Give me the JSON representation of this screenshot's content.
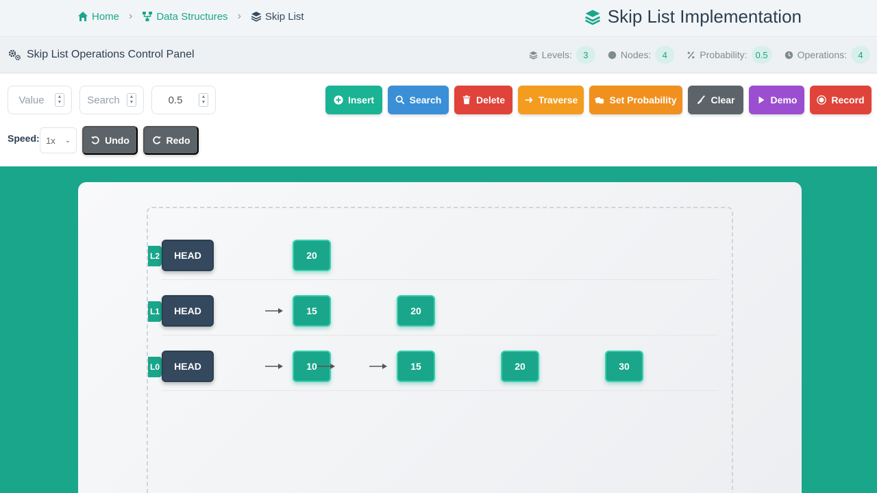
{
  "breadcrumb": {
    "home": "Home",
    "data_structures": "Data Structures",
    "current": "Skip List"
  },
  "app_title": "Skip List Implementation",
  "panel_title": "Skip List Operations Control Panel",
  "stats": {
    "levels_label": "Levels:",
    "levels_value": "3",
    "nodes_label": "Nodes:",
    "nodes_value": "4",
    "probability_label": "Probability:",
    "probability_value": "0.5",
    "operations_label": "Operations:",
    "operations_value": "4"
  },
  "inputs": {
    "value_placeholder": "Value",
    "search_placeholder": "Search",
    "probability_value": "0.5"
  },
  "buttons": {
    "insert": "Insert",
    "search": "Search",
    "delete": "Delete",
    "traverse": "Traverse",
    "set_probability": "Set Probability",
    "clear": "Clear",
    "demo": "Demo",
    "record": "Record",
    "undo": "Undo",
    "redo": "Redo"
  },
  "speed": {
    "label": "Speed:",
    "selected": "1x"
  },
  "colors": {
    "accent": "#1aa68b",
    "insert": "#1ab394",
    "search": "#3a8fd6",
    "delete": "#e0433a",
    "traverse": "#f39c1f",
    "set_probability": "#f0901e",
    "clear": "#5d6469",
    "demo": "#9b4fd0",
    "record": "#e0433a",
    "head": "#34495e"
  },
  "skiplist": {
    "head_label": "HEAD",
    "levels": [
      {
        "tag": "L2",
        "nodes": [
          "20"
        ]
      },
      {
        "tag": "L1",
        "nodes": [
          "15",
          "20"
        ]
      },
      {
        "tag": "L0",
        "nodes": [
          "10",
          "15",
          "20",
          "30"
        ]
      }
    ]
  }
}
